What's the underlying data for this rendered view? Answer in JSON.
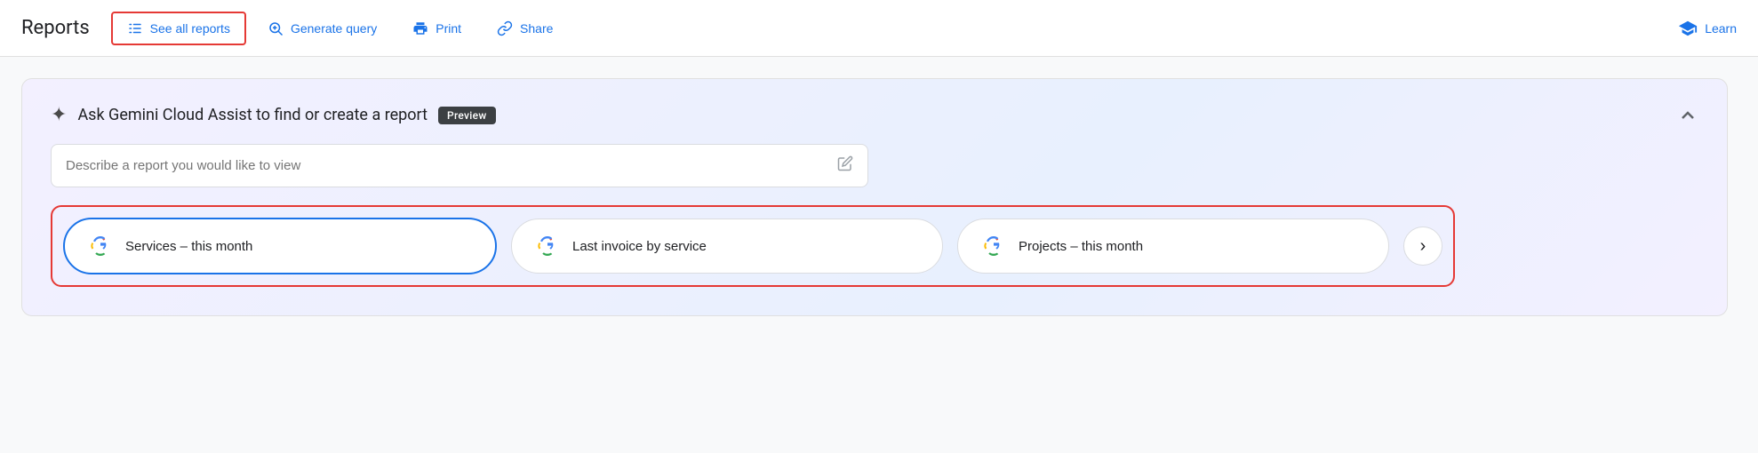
{
  "header": {
    "title": "Reports",
    "nav_items": [
      {
        "id": "see-all-reports",
        "label": "See all reports",
        "icon": "list-icon",
        "highlighted": true
      },
      {
        "id": "generate-query",
        "label": "Generate query",
        "icon": "query-icon",
        "highlighted": false
      },
      {
        "id": "print",
        "label": "Print",
        "icon": "print-icon",
        "highlighted": false
      },
      {
        "id": "share",
        "label": "Share",
        "icon": "share-icon",
        "highlighted": false
      }
    ],
    "learn_label": "Learn",
    "learn_icon": "learn-icon"
  },
  "gemini_section": {
    "sparkle_icon": "✦",
    "title": "Ask Gemini Cloud Assist to find or create a report",
    "preview_badge": "Preview",
    "collapse_icon": "chevron-up-icon",
    "search_placeholder": "Describe a report you would like to view",
    "quick_reports": [
      {
        "id": "services-month",
        "label": "Services – this month",
        "selected": true
      },
      {
        "id": "last-invoice",
        "label": "Last invoice by service",
        "selected": false
      },
      {
        "id": "projects-month",
        "label": "Projects – this month",
        "selected": false
      }
    ],
    "next_btn_label": "›"
  },
  "colors": {
    "blue": "#1a73e8",
    "red_border": "#e53935",
    "dark_text": "#202124",
    "light_text": "#5f6368"
  }
}
